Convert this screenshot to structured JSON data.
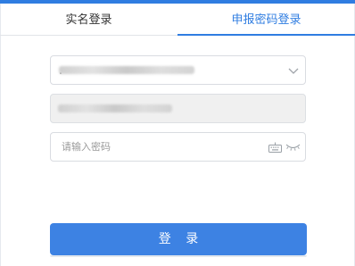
{
  "tabs": [
    {
      "label": "实名登录",
      "active": false
    },
    {
      "label": "申报密码登录",
      "active": true
    }
  ],
  "form": {
    "account_select_value": "",
    "identity_field_value": "",
    "password_placeholder": "请输入密码",
    "login_label": "登 录"
  },
  "icons": {
    "select": "chevron-down-icon",
    "keyboard": "keyboard-icon",
    "visibility": "eye-closed-icon"
  },
  "colors": {
    "accent": "#2f7de1",
    "button": "#3d82e3",
    "disabled_field": "#f0f0f0"
  }
}
